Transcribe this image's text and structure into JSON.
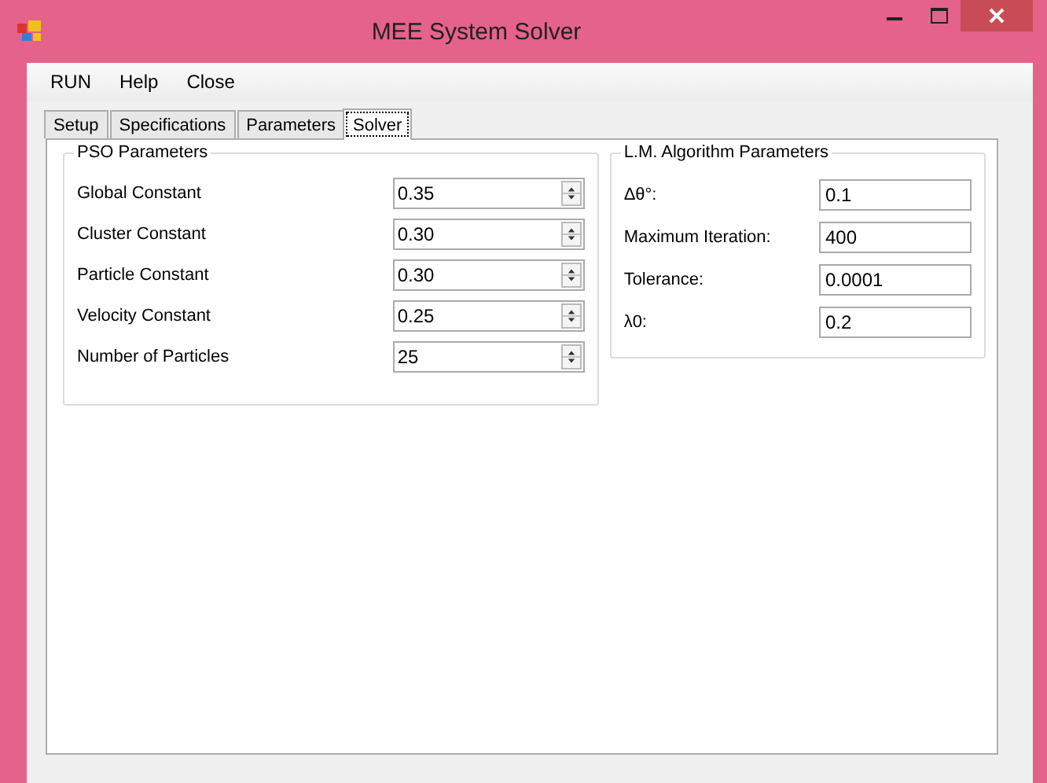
{
  "window": {
    "title": "MEE System Solver"
  },
  "menu": [
    {
      "label": "RUN"
    },
    {
      "label": "Help"
    },
    {
      "label": "Close"
    }
  ],
  "tabs": [
    {
      "label": "Setup",
      "selected": false
    },
    {
      "label": "Specifications",
      "selected": false
    },
    {
      "label": "Parameters",
      "selected": false
    },
    {
      "label": "Solver",
      "selected": true
    }
  ],
  "pso_group": {
    "title": "PSO Parameters",
    "rows": [
      {
        "label": "Global Constant",
        "value": "0.35"
      },
      {
        "label": "Cluster Constant",
        "value": "0.30"
      },
      {
        "label": "Particle Constant",
        "value": "0.30"
      },
      {
        "label": "Velocity Constant",
        "value": "0.25"
      },
      {
        "label": "Number of Particles",
        "value": "25"
      }
    ]
  },
  "lm_group": {
    "title": "L.M. Algorithm Parameters",
    "rows": [
      {
        "label": "Δθ°:",
        "value": "0.1"
      },
      {
        "label": "Maximum Iteration:",
        "value": "400"
      },
      {
        "label": "Tolerance:",
        "value": "0.0001"
      },
      {
        "label": "λ0:",
        "value": "0.2"
      }
    ]
  }
}
